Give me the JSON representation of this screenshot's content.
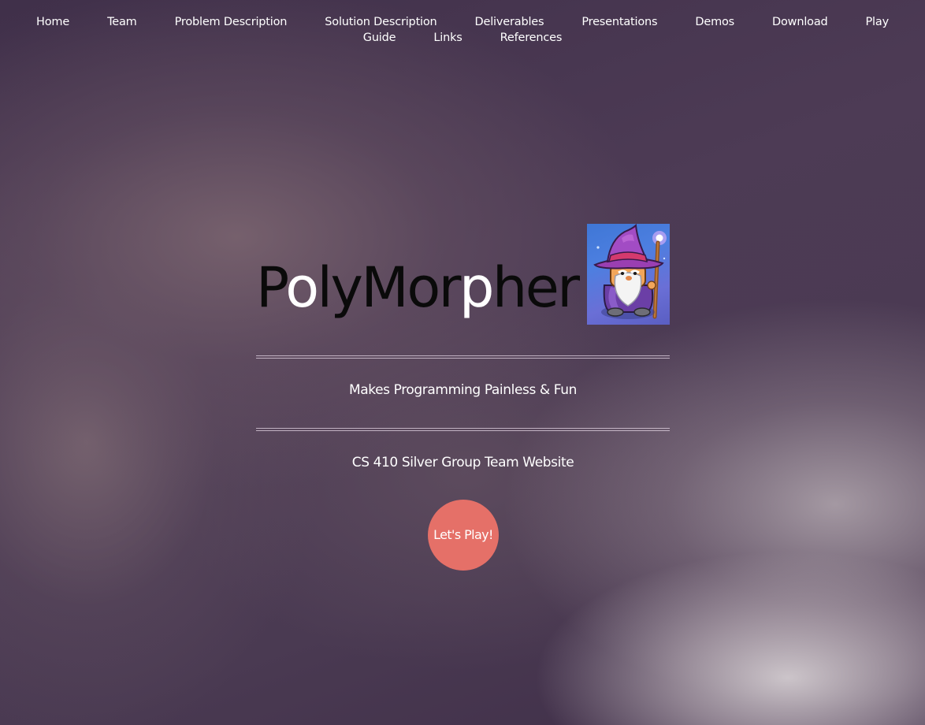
{
  "nav": {
    "items": [
      {
        "label": "Home"
      },
      {
        "label": "Team"
      },
      {
        "label": "Problem Description"
      },
      {
        "label": "Solution Description"
      },
      {
        "label": "Deliverables"
      },
      {
        "label": "Presentations"
      },
      {
        "label": "Demos"
      },
      {
        "label": "Download"
      },
      {
        "label": "Play"
      },
      {
        "label": "Guide"
      },
      {
        "label": "Links"
      },
      {
        "label": "References"
      }
    ]
  },
  "hero": {
    "logo_text": "PolyMorpher",
    "logo_parts": {
      "p1": "P",
      "p2": "o",
      "p3": "ly",
      "p4": "Mor",
      "p5": "p",
      "p6": "her"
    },
    "mascot_icon": "wizard-icon",
    "tagline": "Makes Programming Painless & Fun",
    "subtitle": "CS 410 Silver Group Team Website",
    "cta_label": "Let's Play!"
  },
  "colors": {
    "background": "#47364f",
    "cta_button": "#e57068",
    "text": "#ffffff",
    "logo_dark": "#0a0a0a"
  }
}
